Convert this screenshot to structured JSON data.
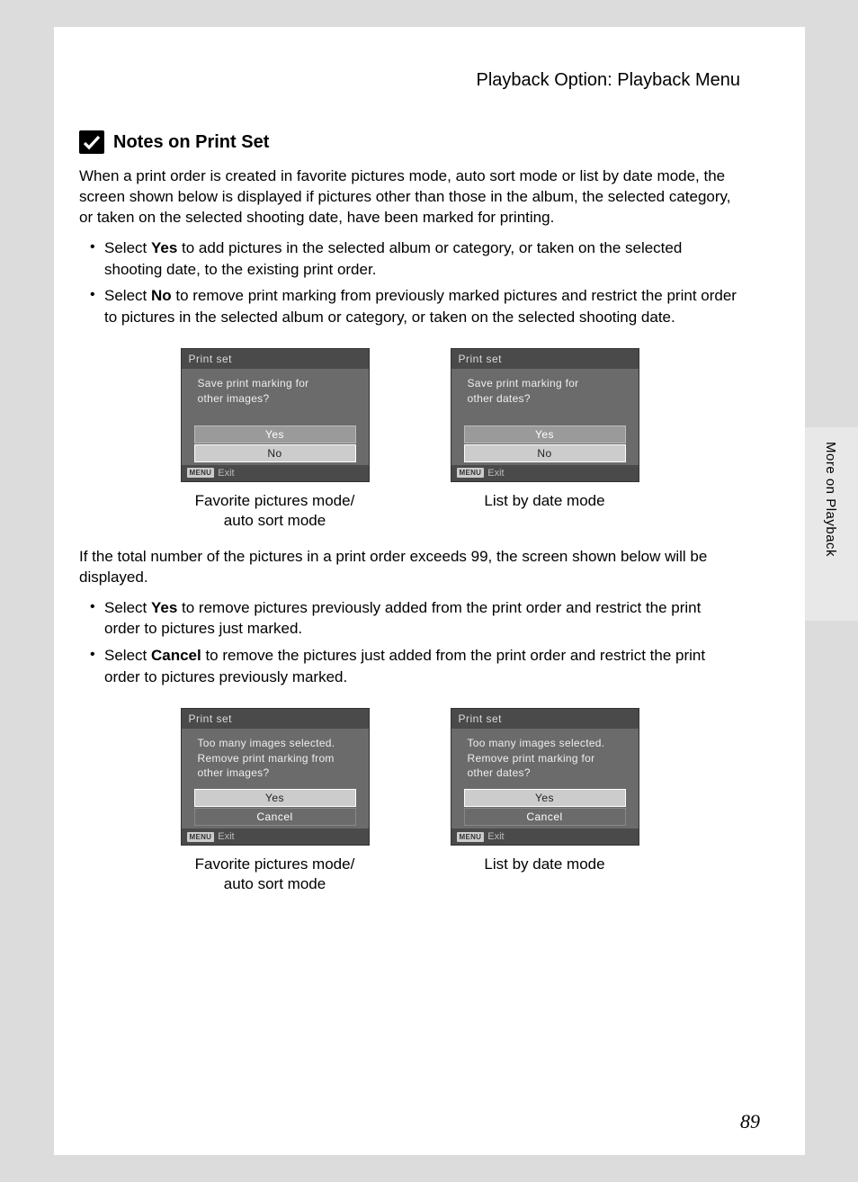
{
  "header": "Playback Option: Playback Menu",
  "section_title": "Notes on Print Set",
  "para1": "When a print order is created in favorite pictures mode, auto sort mode or list by date mode, the screen shown below is displayed if pictures other than those in the album, the selected category, or taken on the selected shooting date, have been marked for printing.",
  "bullets1": {
    "a_pre": "Select ",
    "a_bold": "Yes",
    "a_post": " to add pictures in the selected album or category, or taken on the selected shooting date, to the existing print order.",
    "b_pre": "Select ",
    "b_bold": "No",
    "b_post": " to remove print marking from previously marked pictures and restrict the print order to pictures in the selected album or category, or taken on the selected shooting date."
  },
  "screens1": {
    "left": {
      "title": "Print set",
      "msg_l1": "Save print marking for",
      "msg_l2": "other images?",
      "opt1": "Yes",
      "opt2": "No",
      "exit": "Exit",
      "caption_l1": "Favorite pictures mode/",
      "caption_l2": "auto sort mode"
    },
    "right": {
      "title": "Print set",
      "msg_l1": "Save print marking for",
      "msg_l2": "other dates?",
      "opt1": "Yes",
      "opt2": "No",
      "exit": "Exit",
      "caption_l1": "List by date mode"
    }
  },
  "para2": "If the total number of the pictures in a print order exceeds 99, the screen shown below will be displayed.",
  "bullets2": {
    "a_pre": "Select ",
    "a_bold": "Yes",
    "a_post": " to remove pictures previously added from the print order and restrict the print order to pictures just marked.",
    "b_pre": "Select ",
    "b_bold": "Cancel",
    "b_post": " to remove the pictures just added from the print order and restrict the print order to pictures previously marked."
  },
  "screens2": {
    "left": {
      "title": "Print set",
      "msg_l1": "Too many images selected.",
      "msg_l2": "Remove print marking from",
      "msg_l3": "other images?",
      "opt1": "Yes",
      "opt2": "Cancel",
      "exit": "Exit",
      "caption_l1": "Favorite pictures mode/",
      "caption_l2": "auto sort mode"
    },
    "right": {
      "title": "Print set",
      "msg_l1": "Too many images selected.",
      "msg_l2": "Remove print marking for",
      "msg_l3": "other dates?",
      "opt1": "Yes",
      "opt2": "Cancel",
      "exit": "Exit",
      "caption_l1": "List by date mode"
    }
  },
  "menu_label": "MENU",
  "side_tab": "More on Playback",
  "page_number": "89"
}
